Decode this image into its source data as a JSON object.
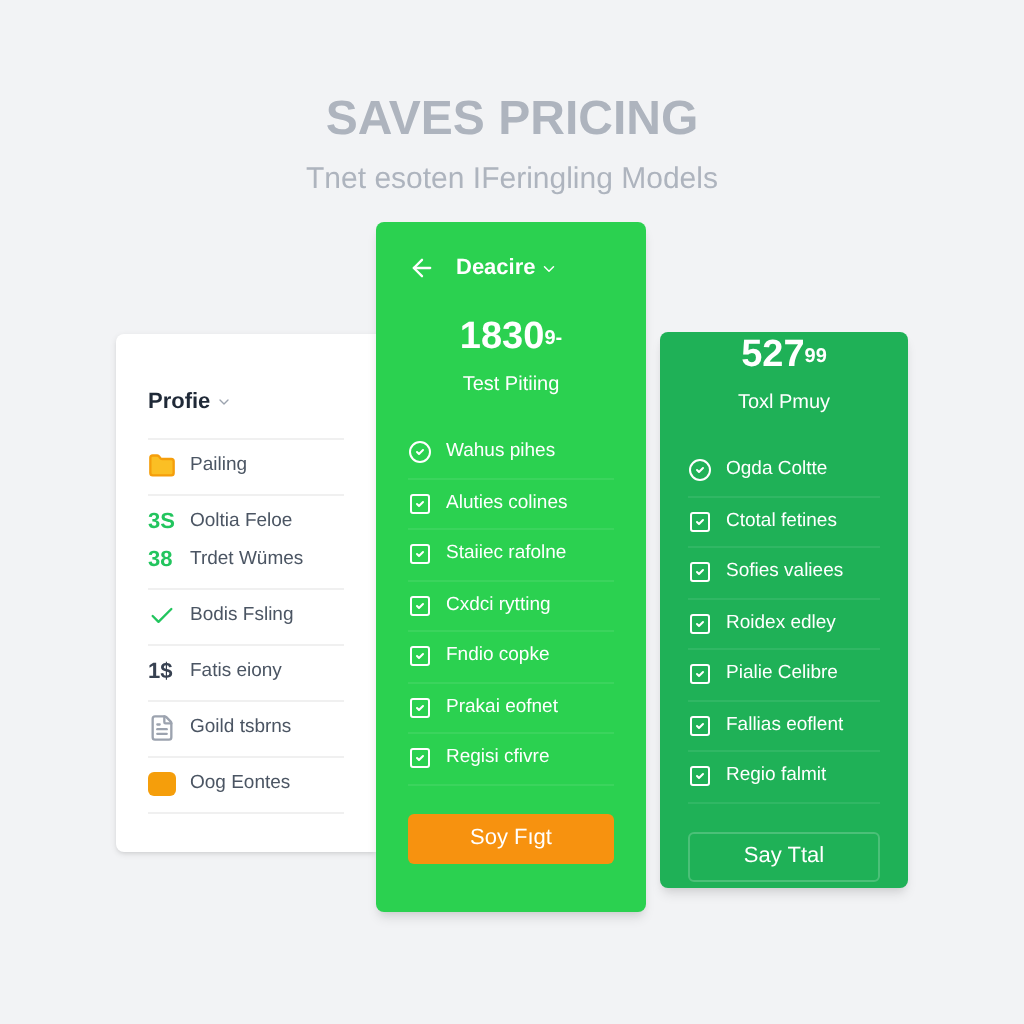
{
  "header": {
    "title": "SAVES PRICING",
    "subtitle": "Tnet esoten IFeringling Models"
  },
  "sidebar": {
    "title": "Profie",
    "groups": [
      [
        {
          "kind": "folder",
          "label": "Pailing"
        }
      ],
      [
        {
          "kind": "mark",
          "mark": "3S",
          "label": "Ooltia Feloe"
        },
        {
          "kind": "mark",
          "mark": "38",
          "label": "Trdet Wümes"
        }
      ],
      [
        {
          "kind": "check",
          "label": "Bodis Fsling"
        }
      ],
      [
        {
          "kind": "glyph",
          "mark": "1$",
          "label": "Fatis eiony"
        }
      ],
      [
        {
          "kind": "doc",
          "label": "Goild tsbrns"
        }
      ],
      [
        {
          "kind": "square",
          "label": "Oog Eontes"
        }
      ]
    ]
  },
  "plans": [
    {
      "kind": "featured",
      "menu": "Deacire",
      "price": "1830",
      "cents": "9-",
      "name": "Test Pitiing",
      "features": [
        "Wahus pihes",
        "Aluties colines",
        "Staiiec rafolne",
        "Cxdci rytting",
        "Fndio copke",
        "Prakai eofnet",
        "Regisi cfivre"
      ],
      "button": "Soy Fıgt"
    },
    {
      "kind": "basic",
      "price": "527",
      "cents": "99",
      "name": "Toxl Pmuy",
      "features": [
        "Ogda Coltte",
        "Ctotal fetines",
        "Sofies valiees",
        "Roidex edley",
        "Pialie Celibre",
        "Fallias eoflent",
        "Regio falmit"
      ],
      "button": "Say Ttal"
    }
  ]
}
